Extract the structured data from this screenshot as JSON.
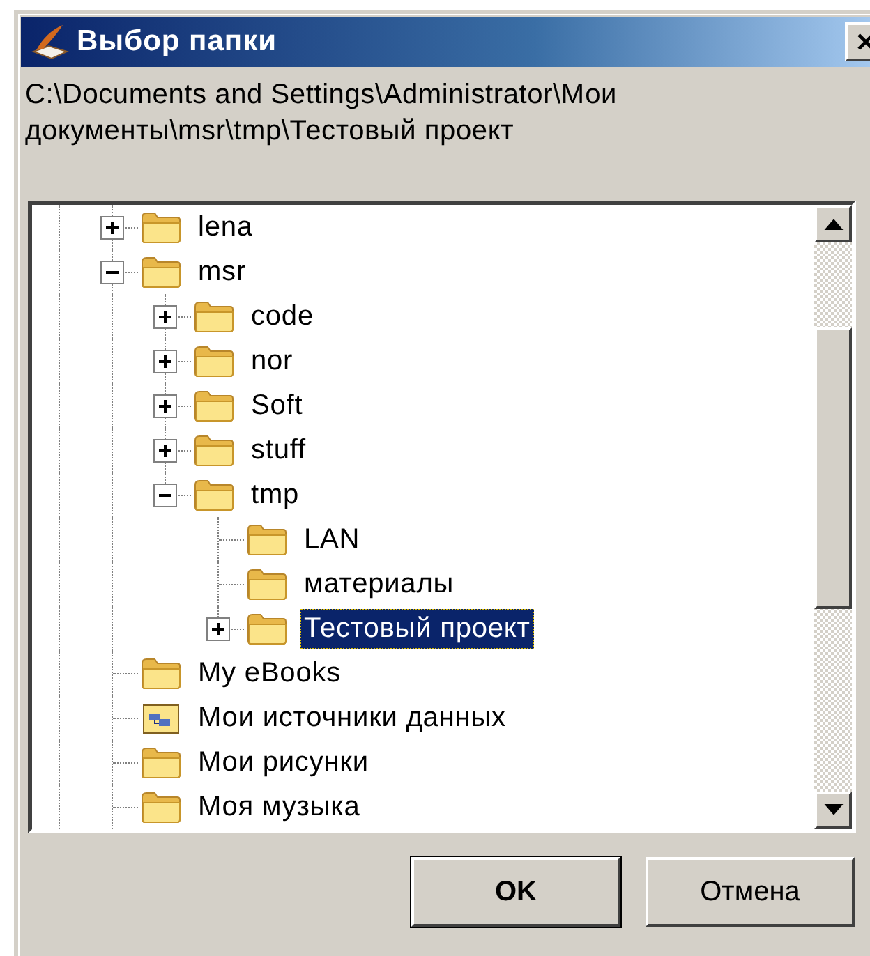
{
  "window": {
    "title": "Выбор папки"
  },
  "path": "C:\\Documents and Settings\\Administrator\\Мои документы\\msr\\tmp\\Тестовый проект",
  "tree": [
    {
      "label": "lena",
      "kind": "folder",
      "expanded": false,
      "selected": false
    },
    {
      "label": "msr",
      "kind": "folder",
      "expanded": true,
      "selected": false,
      "children": [
        {
          "label": "code",
          "kind": "folder",
          "expanded": false,
          "selected": false
        },
        {
          "label": "nor",
          "kind": "folder",
          "expanded": false,
          "selected": false
        },
        {
          "label": "Soft",
          "kind": "folder",
          "expanded": false,
          "selected": false
        },
        {
          "label": "stuff",
          "kind": "folder",
          "expanded": false,
          "selected": false
        },
        {
          "label": "tmp",
          "kind": "folder",
          "expanded": true,
          "selected": false,
          "children": [
            {
              "label": "LAN",
              "kind": "folder",
              "selected": false
            },
            {
              "label": "материалы",
              "kind": "folder",
              "selected": false
            },
            {
              "label": "Тестовый проект",
              "kind": "folder",
              "expanded": false,
              "selected": true
            }
          ]
        }
      ]
    },
    {
      "label": "My eBooks",
      "kind": "folder",
      "selected": false
    },
    {
      "label": "Мои источники данных",
      "kind": "data-sources",
      "selected": false
    },
    {
      "label": "Мои рисунки",
      "kind": "folder",
      "selected": false
    },
    {
      "label": "Моя музыка",
      "kind": "folder",
      "selected": false
    }
  ],
  "buttons": [
    {
      "label": "OK",
      "default": true
    },
    {
      "label": "Отмена",
      "default": false
    }
  ]
}
